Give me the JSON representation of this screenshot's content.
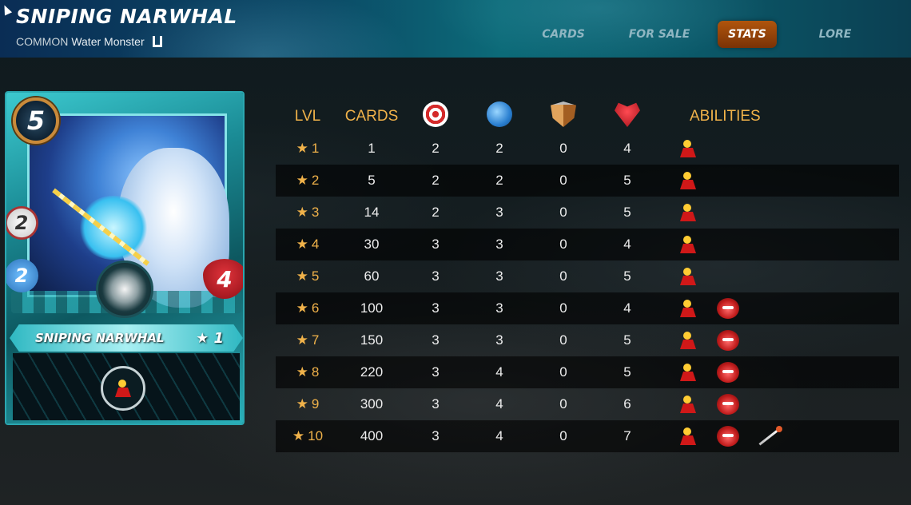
{
  "header": {
    "title": "SNIPING NARWHAL",
    "rarity": "COMMON",
    "type": "Water Monster",
    "tabs": [
      {
        "label": "CARDS",
        "active": false
      },
      {
        "label": "FOR SALE",
        "active": false
      },
      {
        "label": "STATS",
        "active": true
      },
      {
        "label": "LORE",
        "active": false
      }
    ],
    "accent_color": "#f0b24a",
    "active_tab_color": "#9a440a"
  },
  "card": {
    "mana": "5",
    "ranged": "2",
    "speed": "2",
    "health": "4",
    "name": "SNIPING NARWHAL",
    "level": "★ 1",
    "ability_icon": "sniper-icon"
  },
  "table": {
    "headers": {
      "lvl": "LVL",
      "cards": "CARDS",
      "ranged_icon": "ranged-attack-icon",
      "speed_icon": "speed-icon",
      "armor_icon": "armor-icon",
      "health_icon": "health-icon",
      "abilities": "ABILITIES"
    },
    "rows": [
      {
        "lvl": "1",
        "cards": "1",
        "ranged": "2",
        "speed": "2",
        "armor": "0",
        "health": "4",
        "abilities": [
          "sniper"
        ]
      },
      {
        "lvl": "2",
        "cards": "5",
        "ranged": "2",
        "speed": "2",
        "armor": "0",
        "health": "5",
        "abilities": [
          "sniper"
        ]
      },
      {
        "lvl": "3",
        "cards": "14",
        "ranged": "2",
        "speed": "3",
        "armor": "0",
        "health": "5",
        "abilities": [
          "sniper"
        ]
      },
      {
        "lvl": "4",
        "cards": "30",
        "ranged": "3",
        "speed": "3",
        "armor": "0",
        "health": "4",
        "abilities": [
          "sniper"
        ]
      },
      {
        "lvl": "5",
        "cards": "60",
        "ranged": "3",
        "speed": "3",
        "armor": "0",
        "health": "5",
        "abilities": [
          "sniper"
        ]
      },
      {
        "lvl": "6",
        "cards": "100",
        "ranged": "3",
        "speed": "3",
        "armor": "0",
        "health": "4",
        "abilities": [
          "sniper",
          "enrage"
        ]
      },
      {
        "lvl": "7",
        "cards": "150",
        "ranged": "3",
        "speed": "3",
        "armor": "0",
        "health": "5",
        "abilities": [
          "sniper",
          "enrage"
        ]
      },
      {
        "lvl": "8",
        "cards": "220",
        "ranged": "3",
        "speed": "4",
        "armor": "0",
        "health": "5",
        "abilities": [
          "sniper",
          "enrage"
        ]
      },
      {
        "lvl": "9",
        "cards": "300",
        "ranged": "3",
        "speed": "4",
        "armor": "0",
        "health": "6",
        "abilities": [
          "sniper",
          "enrage"
        ]
      },
      {
        "lvl": "10",
        "cards": "400",
        "ranged": "3",
        "speed": "4",
        "armor": "0",
        "health": "7",
        "abilities": [
          "sniper",
          "enrage",
          "piercing"
        ]
      }
    ]
  }
}
